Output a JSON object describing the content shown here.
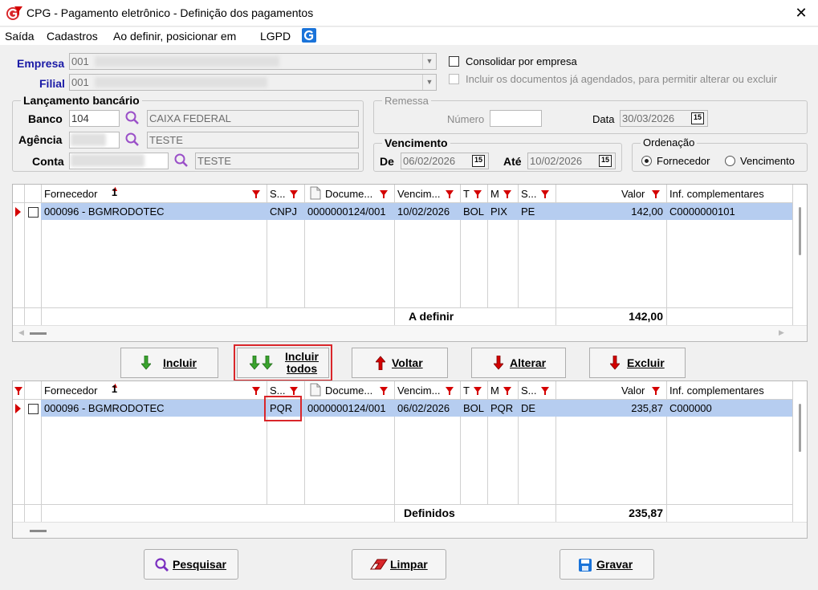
{
  "window": {
    "title": "CPG - Pagamento eletrônico - Definição dos pagamentos",
    "close": "✕"
  },
  "menu": [
    "Saída",
    "Cadastros",
    "Ao definir, posicionar em",
    "LGPD"
  ],
  "empresa": {
    "label": "Empresa",
    "value": "001"
  },
  "filial": {
    "label": "Filial",
    "value": "001"
  },
  "options": {
    "consolidar": "Consolidar por empresa",
    "incluir_agendados": "Incluir os documentos já agendados, para permitir alterar ou excluir"
  },
  "lancamento": {
    "title": "Lançamento bancário",
    "banco_label": "Banco",
    "banco_code": "104",
    "banco_name": "CAIXA FEDERAL",
    "agencia_label": "Agência",
    "agencia_name": "TESTE",
    "conta_label": "Conta",
    "conta_name": "TESTE"
  },
  "remessa": {
    "title": "Remessa",
    "numero_label": "Número",
    "numero_value": "",
    "data_label": "Data",
    "data_value": "30/03/2026"
  },
  "vencimento": {
    "title": "Vencimento",
    "de_label": "De",
    "de_value": "06/02/2026",
    "ate_label": "Até",
    "ate_value": "10/02/2026"
  },
  "ordenacao": {
    "title": "Ordenação",
    "opt1": "Fornecedor",
    "opt2": "Vencimento",
    "selected": "Fornecedor"
  },
  "cal_glyph": "15",
  "grid_headers": {
    "fornecedor": "Fornecedor",
    "sort": "1",
    "s": "S...",
    "doc": "Docume...",
    "venc": "Vencim...",
    "t": "T",
    "m": "M",
    "s2": "S...",
    "valor": "Valor",
    "inf": "Inf. complementares"
  },
  "grid_top": {
    "row": {
      "fornecedor": "000096 - BGMRODOTEC",
      "s": "CNPJ",
      "doc": "0000000124/001",
      "venc": "10/02/2026",
      "t": "BOL",
      "m": "PIX",
      "s2": "PE",
      "valor": "142,00",
      "inf": "C0000000101"
    },
    "footer_label": "A definir",
    "footer_total": "142,00"
  },
  "grid_bottom": {
    "row": {
      "fornecedor": "000096 - BGMRODOTEC",
      "s": "PQR",
      "doc": "0000000124/001",
      "venc": "06/02/2026",
      "t": "BOL",
      "m": "PQR",
      "s2": "DE",
      "valor": "235,87",
      "inf": "C000000"
    },
    "footer_label": "Definidos",
    "footer_total": "235,87"
  },
  "buttons": {
    "incluir": "Incluir",
    "incluir_todos_1": "Incluir",
    "incluir_todos_2": "todos",
    "voltar": "Voltar",
    "alterar": "Alterar",
    "excluir": "Excluir",
    "pesquisar": "Pesquisar",
    "limpar": "Limpar",
    "gravar": "Gravar"
  },
  "colors": {
    "accent": "#1a1aa6",
    "row_selected": "#b6cdf0",
    "red": "#d40000",
    "green": "#3aa32e",
    "highlight": "#d9262a"
  }
}
